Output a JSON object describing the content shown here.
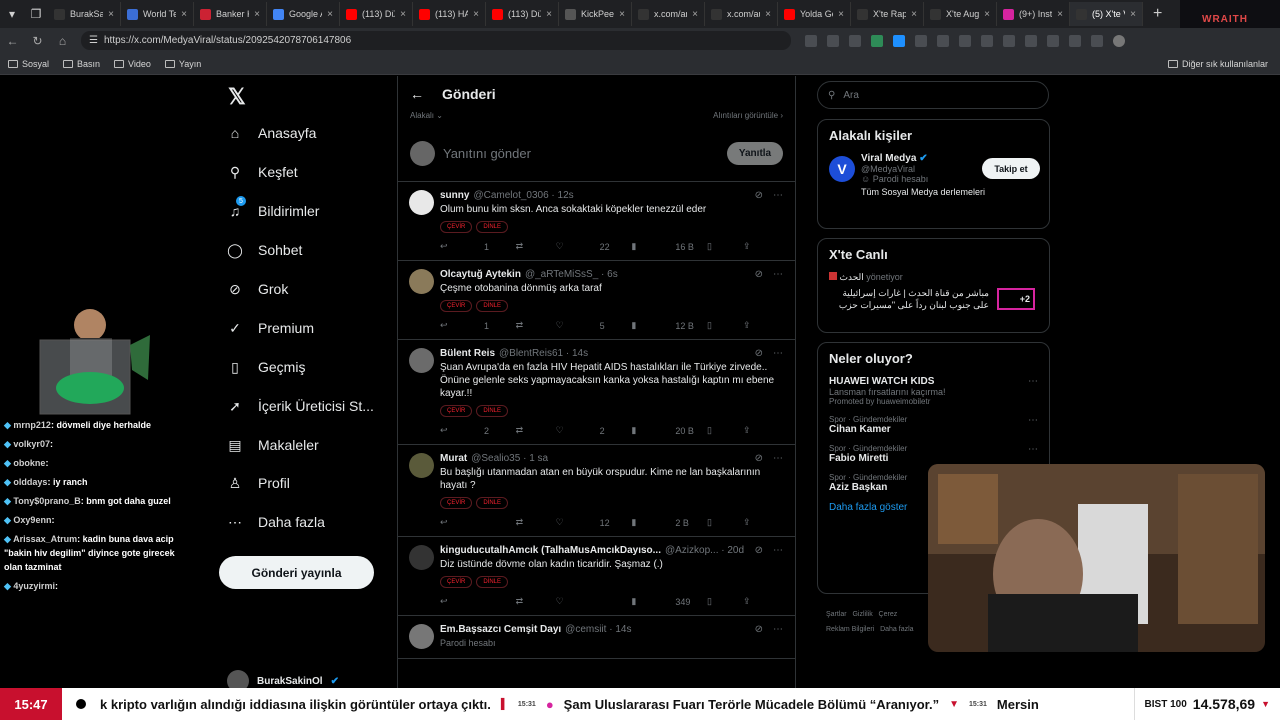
{
  "browser": {
    "tabs": [
      {
        "title": "BurakSaki",
        "color": "#333"
      },
      {
        "title": "World Te",
        "color": "#3b6ed5"
      },
      {
        "title": "Banker K",
        "color": "#c23"
      },
      {
        "title": "Google A",
        "color": "#4285f4"
      },
      {
        "title": "(113) Dü",
        "color": "#f00"
      },
      {
        "title": "(113) HA",
        "color": "#f00"
      },
      {
        "title": "(113) Dü",
        "color": "#f00"
      },
      {
        "title": "KickPeek",
        "color": "#555"
      },
      {
        "title": "x.com/an",
        "color": "#333"
      },
      {
        "title": "x.com/au",
        "color": "#333"
      },
      {
        "title": "Yolda Gö",
        "color": "#f00"
      },
      {
        "title": "X'te Rap",
        "color": "#333"
      },
      {
        "title": "X'te Augu",
        "color": "#333"
      },
      {
        "title": "(9+) Insta",
        "color": "#d6249f"
      },
      {
        "title": "(5) X'te V",
        "color": "#333",
        "active": true
      }
    ],
    "url": "https://x.com/MedyaViral/status/2092542078706147806",
    "bookmarks": [
      "Sosyal",
      "Basın",
      "Video",
      "Yayın"
    ],
    "bookmarks_other": "Diğer sık kullanılanlar"
  },
  "nav": {
    "items": [
      {
        "label": "Anasayfa",
        "icon": "home-icon",
        "glyph": "⌂"
      },
      {
        "label": "Keşfet",
        "icon": "search-icon",
        "glyph": "⚲"
      },
      {
        "label": "Bildirimler",
        "icon": "bell-icon",
        "glyph": "♫",
        "badge": "5"
      },
      {
        "label": "Sohbet",
        "icon": "chat-icon",
        "glyph": "◯"
      },
      {
        "label": "Grok",
        "icon": "grok-icon",
        "glyph": "⊘"
      },
      {
        "label": "Premium",
        "icon": "premium-icon",
        "glyph": "✓"
      },
      {
        "label": "Geçmiş",
        "icon": "bookmark-icon",
        "glyph": "▯"
      },
      {
        "label": "İçerik Üreticisi St...",
        "icon": "rocket-icon",
        "glyph": "➚"
      },
      {
        "label": "Makaleler",
        "icon": "article-icon",
        "glyph": "▤"
      },
      {
        "label": "Profil",
        "icon": "profile-icon",
        "glyph": "♙"
      },
      {
        "label": "Daha fazla",
        "icon": "more-icon",
        "glyph": "⋯"
      }
    ],
    "post_button": "Gönderi yayınla",
    "account_name": "BurakSakinOl"
  },
  "main": {
    "title": "Gönderi",
    "subhead_left": "Alakalı",
    "subhead_right": "Alıntıları görüntüle",
    "reply_placeholder": "Yanıtını gönder",
    "reply_button": "Yanıtla",
    "chip1": "ÇEVİR",
    "chip2": "DİNLE",
    "tweets": [
      {
        "name": "sunny",
        "handle": "@Camelot_0306 · 12s",
        "text": "Olum bunu kim sksn. Anca sokaktaki köpekler tenezzül eder",
        "replies": "1",
        "likes": "22",
        "views": "16 B",
        "avatar": "#e8e8e8"
      },
      {
        "name": "Olcaytuğ Aytekin",
        "handle": "@_aRTeMiSsS_ · 6s",
        "text": "Çeşme otobanina dönmüş arka taraf",
        "replies": "1",
        "likes": "5",
        "views": "12 B",
        "avatar": "#8a7a5a"
      },
      {
        "name": "Bülent Reis",
        "handle": "@BlentReis61 · 14s",
        "text": "Şuan Avrupa'da en fazla HIV Hepatit AIDS hastalıkları ile Türkiye zirvede.. Önüne gelenle seks yapmayacaksın kanka yoksa hastalığı kaptın mı ebene kayar.!!",
        "replies": "2",
        "likes": "2",
        "views": "20 B",
        "avatar": "#6b6b6b"
      },
      {
        "name": "Murat",
        "handle": "@Sealio35 · 1 sa",
        "text": "Bu başlığı utanmadan atan en büyük orspudur. Kime ne lan başkalarının hayatı ?",
        "replies": "",
        "likes": "12",
        "views": "2 B",
        "avatar": "#5a5a3a"
      },
      {
        "name": "kinguducutalhAmcık (TalhaMusAmcıkDayıso...",
        "handle": "@Azizkop... · 20d",
        "text": "Diz üstünde dövme olan kadın ticaridir. Şaşmaz (.)",
        "replies": "",
        "likes": "",
        "views": "349",
        "avatar": "#333"
      },
      {
        "name": "Em.Başsazcı Cemşit Dayı",
        "handle": "@cemsiit · 14s",
        "text": "Parodi hesabı",
        "replies": "",
        "likes": "",
        "views": "",
        "avatar": "#777"
      }
    ]
  },
  "right": {
    "search_placeholder": "Ara",
    "related_title": "Alakalı kişiler",
    "person_name": "Viral Medya",
    "person_handle": "@MedyaViral",
    "person_parody": "Parodi hesabı",
    "person_bio": "Tüm Sosyal Medya derlemeleri",
    "follow_button": "Takip et",
    "live_title": "X'te Canlı",
    "live_host": "الحدث",
    "live_host_suffix": "yönetiyor",
    "live_text": "مباشر من قناة الحدث | غارات إسرائيلية على جنوب لبنان رداً على \"مسيرات حزب",
    "live_plus": "+2",
    "news_title": "Neler oluyor?",
    "trends": [
      {
        "top": "HUAWEI WATCH KIDS",
        "sub": "Lansman fırsatlarını kaçırma!",
        "promo": "Promoted by huaweimobiletr"
      },
      {
        "top": "Spor · Gündemdekiler",
        "sub": "Cihan Kamer"
      },
      {
        "top": "Spor · Gündemdekiler",
        "sub": "Fabio Miretti"
      },
      {
        "top": "Spor · Gündemdekiler",
        "sub": "Aziz Başkan"
      }
    ],
    "show_more": "Daha fazla göster",
    "footer": [
      "Şartlar",
      "Gizlilik",
      "Çerez",
      "Reklam Bilgileri",
      "Daha fazla"
    ]
  },
  "chat": [
    {
      "user": "mrnp212",
      "msg": "dövmeli diye herhalde"
    },
    {
      "user": "volkyr07",
      "msg": ""
    },
    {
      "user": "obokne",
      "msg": ""
    },
    {
      "user": "olddays",
      "msg": "iy ranch"
    },
    {
      "user": "Tony$0prano_B",
      "msg": "bnm got daha guzel"
    },
    {
      "user": "Oxy9enn",
      "msg": ""
    },
    {
      "user": "Arissax_Atrum",
      "msg": "kadin buna dava acip \"bakin hiv degilim\" diyince gote girecek olan tazminat"
    },
    {
      "user": "4yuzyirmi",
      "msg": ""
    }
  ],
  "ticker": {
    "time": "15:47",
    "item1": "k kripto varlığın alındığı iddiasına ilişkin görüntüler ortaya çıktı.",
    "time2": "15:31",
    "item2": "Şam Uluslararası Fuarı Terörle Mücadele Bölümü “Aranıyor.”",
    "time3": "15:31",
    "item3": "Mersin",
    "bist_label": "BIST 100",
    "bist_value": "14.578,69"
  },
  "colors": {
    "accent": "#1d9bf0",
    "ticker_red": "#c8102e",
    "chip_red": "#f4212e"
  }
}
